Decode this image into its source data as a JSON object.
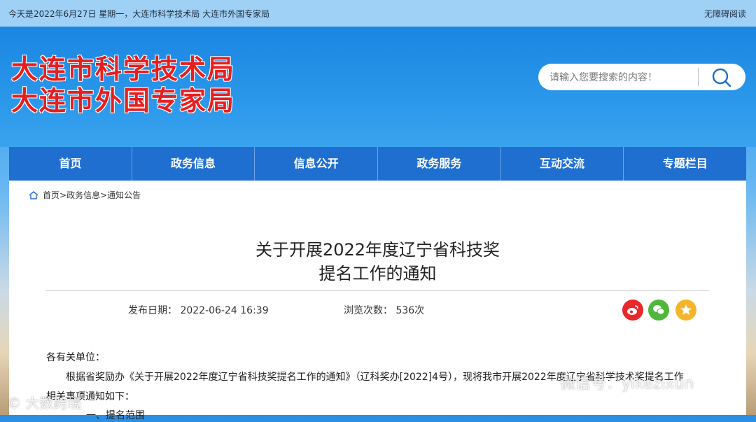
{
  "topbar": {
    "date_line": "今天是2022年6月27日 星期一，大连市科学技术局 大连市外国专家局",
    "accessibility": "无障碍阅读"
  },
  "header": {
    "logo_line1": "大连市科学技术局",
    "logo_line2": "大连市外国专家局",
    "search_placeholder": "请输入您要搜索的内容！"
  },
  "nav": {
    "items": [
      {
        "label": "首页"
      },
      {
        "label": "政务信息"
      },
      {
        "label": "信息公开"
      },
      {
        "label": "政务服务"
      },
      {
        "label": "互动交流"
      },
      {
        "label": "专题栏目"
      }
    ]
  },
  "breadcrumb": {
    "items": [
      "首页",
      "政务信息",
      "通知公告"
    ],
    "separator": ">"
  },
  "article": {
    "title_line1": "关于开展2022年度辽宁省科技奖",
    "title_line2": "提名工作的通知",
    "publish_label": "发布日期：",
    "publish_date": "2022-06-24  16:39",
    "views_label": "浏览次数：",
    "views_count": "536次",
    "paragraphs": [
      "各有关单位：",
      "根据省奖励办《关于开展2022年度辽宁省科技奖提名工作的通知》（辽科奖办[2022]4号），现将我市开展2022年度辽宁省科学技术奖提名工作",
      "相关事项通知如下：",
      "一、提名范围"
    ]
  },
  "share": {
    "icons": [
      "weibo-icon",
      "wechat-icon",
      "star-icon"
    ]
  },
  "watermarks": {
    "left": "© 大数跨境",
    "right": "微信号：yikezixun"
  },
  "colors": {
    "nav_bg": "#1f6fd1",
    "logo_red": "#e81e1e",
    "topbar_bg": "#9fd0f5",
    "weibo": "#e8282a",
    "wechat": "#4fb83b",
    "favorite": "#f4b52a"
  }
}
